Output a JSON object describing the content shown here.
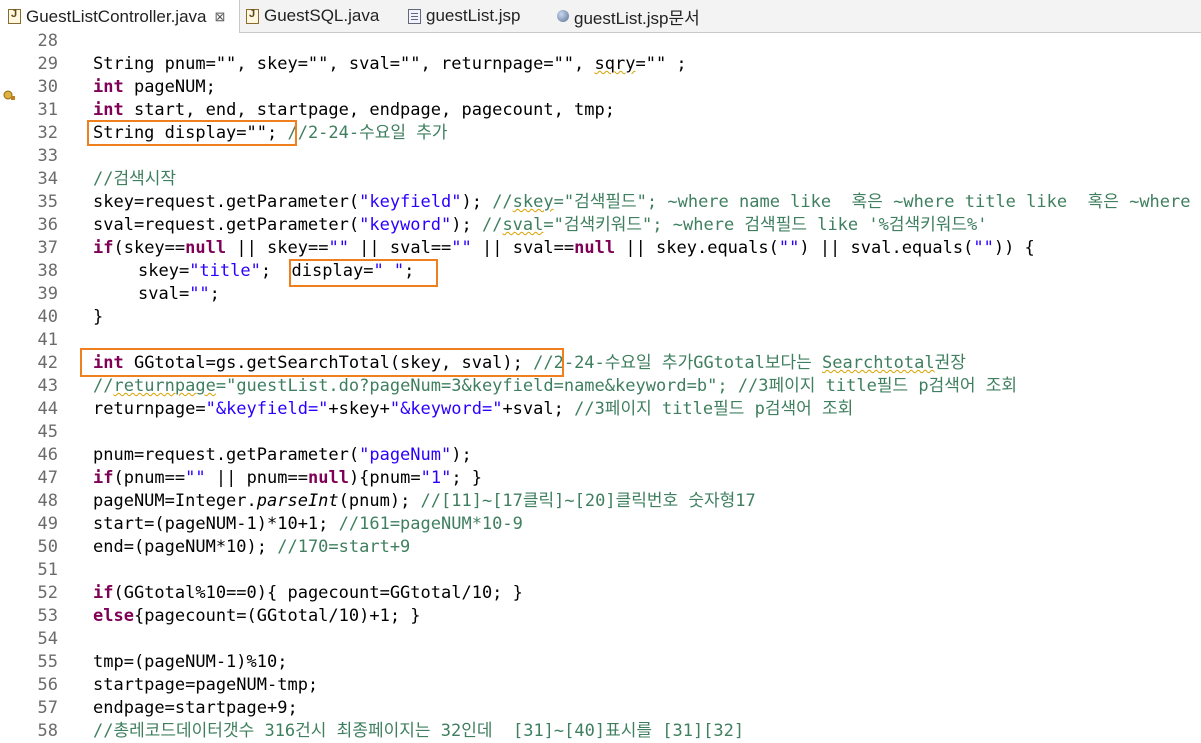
{
  "tabs": [
    {
      "label": "GuestListController.java",
      "icon": "java-file-icon",
      "close": "⊠",
      "active": true
    },
    {
      "label": "GuestSQL.java",
      "icon": "java-file-icon"
    },
    {
      "label": "guestList.jsp",
      "icon": "jsp-file-icon"
    },
    {
      "label": "guestList.jsp문서",
      "icon": "globe-icon"
    }
  ],
  "line_numbers": [
    "28",
    "29",
    "30",
    "31",
    "32",
    "33",
    "34",
    "35",
    "36",
    "37",
    "38",
    "39",
    "40",
    "41",
    "42",
    "43",
    "44",
    "45",
    "46",
    "47",
    "48",
    "49",
    "50",
    "51",
    "52",
    "53",
    "54",
    "55",
    "56",
    "57",
    "58"
  ],
  "code": {
    "l29_a": "String pnum=\"\", skey=\"\", sval=\"\", returnpage=\"\", ",
    "l29_b": "sqry",
    "l29_c": "=\"\" ;",
    "l30_kw": "int",
    "l30": " pageNUM;",
    "l31_kw": "int",
    "l31": " start, end, startpage, endpage, pagecount, tmp;",
    "l32_a": "String display=\"\";",
    "l32_c": " //2-24-수요일 추가",
    "l34_c": "//검색시작",
    "l35_a": "skey=request.getParameter(",
    "l35_s": "\"keyfield\"",
    "l35_b": "); ",
    "l35_c": "//",
    "l35_c_sq": "skey",
    "l35_c2": "=\"검색필드\"; ~where name like  혹은 ~where title like  혹은 ~where",
    "l36_a": "sval=request.getParameter(",
    "l36_s": "\"keyword\"",
    "l36_b": "); ",
    "l36_c": "//",
    "l36_c_sq": "sval",
    "l36_c2": "=\"검색키워드\"; ~where 검색필드 like '%검색키워드%'",
    "l37_kw": "if",
    "l37_a": "(skey==",
    "l37_kw2": "null",
    "l37_b": " || skey==",
    "l37_s1": "\"\"",
    "l37_c": " || sval==",
    "l37_s2": "\"\"",
    "l37_d": " || sval==",
    "l37_kw3": "null",
    "l37_e": " || skey.equals(",
    "l37_s3": "\"\"",
    "l37_f": ") || sval.equals(",
    "l37_s4": "\"\"",
    "l37_g": ")) {",
    "l38_a": "skey=",
    "l38_s": "\"title\"",
    "l38_b": ";  display=",
    "l38_s2": "\" \"",
    "l38_c": ";",
    "l39_a": "sval=",
    "l39_s": "\"\"",
    "l39_b": ";",
    "l40": "}",
    "l42_kw": "int",
    "l42_a": " GGtotal=gs.getSearchTotal(skey, sval);",
    "l42_c": " //2-24-수요일 추가GGtotal보다는 ",
    "l42_c_sq": "Searchtotal",
    "l42_c2": "권장",
    "l43_c": "//",
    "l43_c_sq": "returnpage",
    "l43_c2": "=\"guestList.do?pageNum=3&keyfield=name&keyword=b\"; //3페이지 title필드 p검색어 조회",
    "l44_a": "returnpage=",
    "l44_s1": "\"&keyfield=\"",
    "l44_b": "+skey+",
    "l44_s2": "\"&keyword=\"",
    "l44_c": "+sval; ",
    "l44_cm": "//3페이지 title필드 p검색어 조회",
    "l46_a": "pnum=request.getParameter(",
    "l46_s": "\"pageNum\"",
    "l46_b": ");",
    "l47_kw": "if",
    "l47_a": "(pnum==",
    "l47_s1": "\"\"",
    "l47_b": " || pnum==",
    "l47_kw2": "null",
    "l47_c": "){pnum=",
    "l47_s2": "\"1\"",
    "l47_d": "; }",
    "l48_a": "pageNUM=Integer.",
    "l48_it": "parseInt",
    "l48_b": "(pnum); ",
    "l48_c": "//[11]~[17클릭]~[20]클릭번호 숫자형17",
    "l49_a": "start=(pageNUM-1)*10+1; ",
    "l49_c": "//161=pageNUM*10-9",
    "l50_a": "end=(pageNUM*10); ",
    "l50_c": "//170=start+9",
    "l52_kw": "if",
    "l52_a": "(GGtotal%10==0){ pagecount=GGtotal/10; }",
    "l53_kw": "else",
    "l53_a": "{pagecount=(GGtotal/10)+1; }",
    "l55": "tmp=(pageNUM-1)%10;",
    "l56": "startpage=pageNUM-tmp;",
    "l57": "endpage=startpage+9;",
    "l58_c": "//총레코드데이터갯수 316건시 최종페이지는 32인데  [31]~[40]표시를 [31][32]"
  }
}
